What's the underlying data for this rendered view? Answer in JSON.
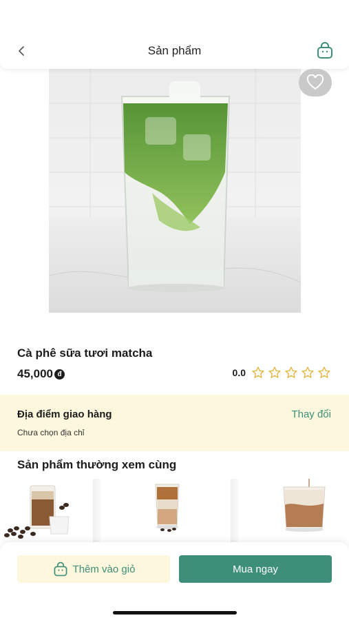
{
  "header": {
    "title": "Sản phẩm",
    "back_icon": "chevron-left-icon",
    "cart_icon": "shopping-bag-icon"
  },
  "product": {
    "name": "Cà phê sữa tươi matcha",
    "price": "45,000",
    "currency_symbol": "đ",
    "rating_value": "0.0",
    "rating_stars": 0,
    "max_stars": 5,
    "favorite_icon": "heart-icon"
  },
  "delivery": {
    "title": "Địa điểm giao hàng",
    "change_label": "Thay đổi",
    "address": "Chưa chọn địa chỉ"
  },
  "related": {
    "title": "Sản phẩm thường xem cùng",
    "items": [
      {
        "image": "iced-coffee-with-beans"
      },
      {
        "image": "layered-iced-coffee-tall-glass"
      },
      {
        "image": "iced-latte-short-glass"
      }
    ]
  },
  "actions": {
    "add_to_cart_label": "Thêm vào giỏ",
    "buy_now_label": "Mua ngay"
  },
  "colors": {
    "accent": "#3d8f7a",
    "cream": "#fdf7dd",
    "matcha": "#6fa83a",
    "star": "#e0b43a"
  }
}
